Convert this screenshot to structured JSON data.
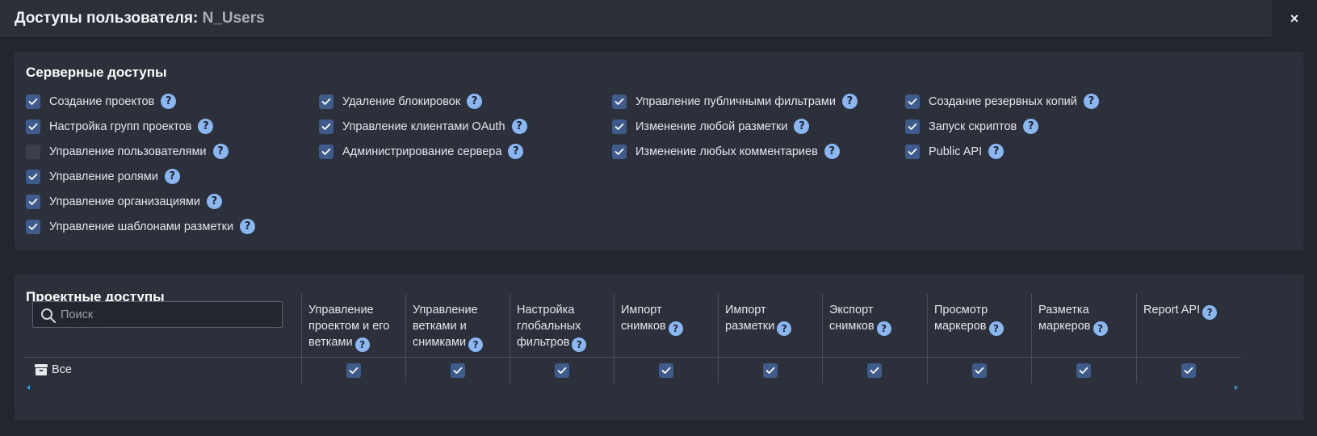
{
  "window": {
    "title": "Доступы пользователя:",
    "username": "N_Users",
    "close_label": "×"
  },
  "server": {
    "heading": "Серверные доступы",
    "columns": [
      [
        {
          "label": "Создание проектов",
          "checked": true
        },
        {
          "label": "Настройка групп проектов",
          "checked": true
        },
        {
          "label": "Управление пользователями",
          "checked": false
        },
        {
          "label": "Управление ролями",
          "checked": true
        },
        {
          "label": "Управление организациями",
          "checked": true
        },
        {
          "label": "Управление шаблонами разметки",
          "checked": true
        }
      ],
      [
        {
          "label": "Удаление блокировок",
          "checked": true
        },
        {
          "label": "Управление клиентами OAuth",
          "checked": true
        },
        {
          "label": "Администрирование сервера",
          "checked": true
        }
      ],
      [
        {
          "label": "Управление публичными фильтрами",
          "checked": true
        },
        {
          "label": "Изменение любой разметки",
          "checked": true
        },
        {
          "label": "Изменение любых комментариев",
          "checked": true
        }
      ],
      [
        {
          "label": "Создание резервных копий",
          "checked": true
        },
        {
          "label": "Запуск скриптов",
          "checked": true
        },
        {
          "label": "Public API",
          "checked": true
        }
      ]
    ]
  },
  "project": {
    "heading": "Проектные доступы",
    "search_placeholder": "Поиск",
    "columns": [
      {
        "lines": [
          "Управление",
          "проектом и его",
          "ветками"
        ]
      },
      {
        "lines": [
          "Управление",
          "ветками и",
          "снимками"
        ]
      },
      {
        "lines": [
          "Настройка",
          "глобальных",
          "фильтров"
        ]
      },
      {
        "lines": [
          "Импорт",
          "снимков"
        ]
      },
      {
        "lines": [
          "Импорт",
          "разметки"
        ]
      },
      {
        "lines": [
          "Экспорт",
          "снимков"
        ]
      },
      {
        "lines": [
          "Просмотр",
          "маркеров"
        ]
      },
      {
        "lines": [
          "Разметка",
          "маркеров"
        ]
      },
      {
        "lines": [
          "Report API"
        ]
      }
    ],
    "rows": [
      {
        "label": "Все",
        "icon": "archive-icon",
        "values": [
          true,
          true,
          true,
          true,
          true,
          true,
          true,
          true,
          true
        ]
      }
    ]
  },
  "help_glyph": "?",
  "colors": {
    "checkbox_checked": "#3e5b8c",
    "checkbox_unchecked": "#3a3f49",
    "help_icon": "#8ab7f2",
    "panel": "#2c303a",
    "background": "#23262e"
  }
}
